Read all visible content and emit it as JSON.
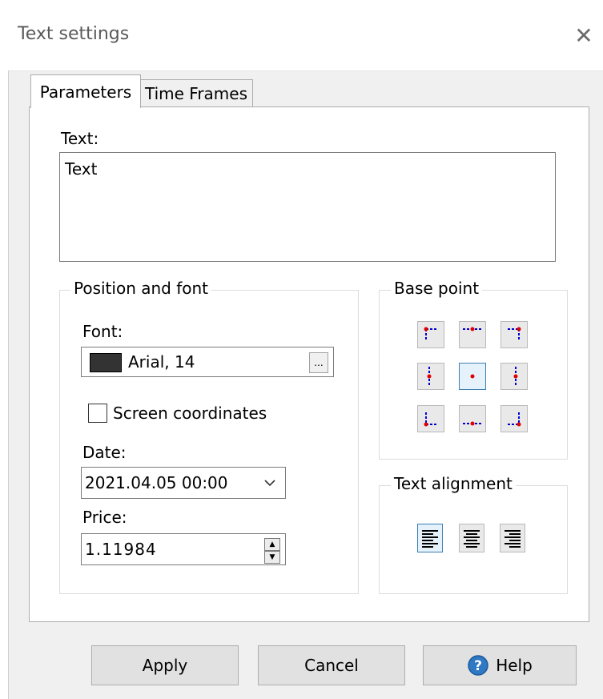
{
  "window": {
    "title": "Text settings"
  },
  "tabs": [
    {
      "label": "Parameters",
      "active": true
    },
    {
      "label": "Time Frames",
      "active": false
    }
  ],
  "text_field": {
    "label": "Text:",
    "value": "Text"
  },
  "position_font": {
    "title": "Position and font",
    "font_label": "Font:",
    "font_value": "Arial, 14",
    "font_color": "#333333",
    "browse_label": "...",
    "screen_coordinates_label": "Screen coordinates",
    "screen_coordinates_checked": false,
    "date_label": "Date:",
    "date_value": "2021.04.05 00:00",
    "price_label": "Price:",
    "price_value": "1.11984"
  },
  "base_point": {
    "title": "Base point",
    "selected": "center",
    "options": [
      "top-left",
      "top-center",
      "top-right",
      "middle-left",
      "center",
      "middle-right",
      "bottom-left",
      "bottom-center",
      "bottom-right"
    ]
  },
  "text_alignment": {
    "title": "Text alignment",
    "selected": "left",
    "options": [
      "left",
      "center",
      "right"
    ]
  },
  "buttons": {
    "apply": "Apply",
    "cancel": "Cancel",
    "help": "Help"
  },
  "colors": {
    "accent": "#3c7fb1",
    "point_red": "#e00000",
    "line_blue": "#0000d0"
  }
}
